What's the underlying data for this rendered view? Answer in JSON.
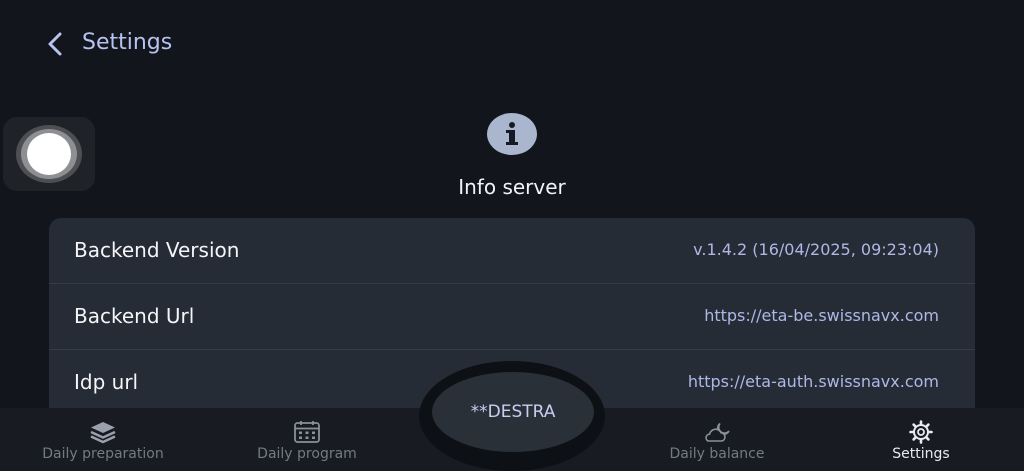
{
  "header": {
    "back_icon": "chevron-left-icon",
    "title": "Settings"
  },
  "section": {
    "icon": "info-circle-icon",
    "title": "Info server"
  },
  "info_rows": [
    {
      "label": "Backend Version",
      "value": "v.1.4.2 (16/04/2025, 09:23:04)"
    },
    {
      "label": "Backend Url",
      "value": "https://eta-be.swissnavx.com"
    },
    {
      "label": "Idp url",
      "value": "https://eta-auth.swissnavx.com"
    }
  ],
  "center_button": {
    "label": "**DESTRA"
  },
  "nav": {
    "items": [
      {
        "label": "Daily preparation",
        "icon": "stack-layers-icon",
        "active": false
      },
      {
        "label": "Daily program",
        "icon": "calendar-icon",
        "active": false
      },
      {
        "label": "Daily balance",
        "icon": "cloud-moon-icon",
        "active": false
      },
      {
        "label": "Settings",
        "icon": "gear-icon",
        "active": true
      }
    ]
  },
  "colors": {
    "background": "#12161c",
    "card": "#262c36",
    "accent_text": "#aeb8e6",
    "nav_background": "#181c22"
  }
}
